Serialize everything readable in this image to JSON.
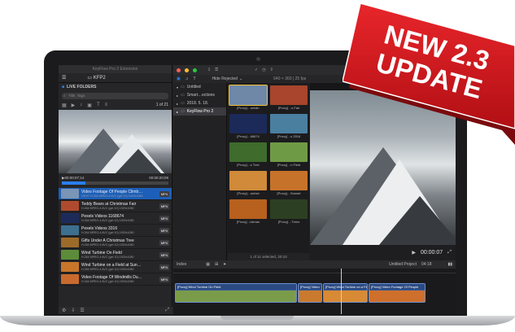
{
  "left_app": {
    "window_title": "KeyFlow Pro 2 Extension",
    "library": "KFP2",
    "folders_label": "LIVE FOLDERS",
    "search_placeholder": "Title, Tags",
    "page": "1 of 21",
    "time_current": "00:00:07;14",
    "time_total": "00:00:20;09",
    "clips": [
      {
        "name": "Video Footage Of People Climb…",
        "meta": "HEVC H.264 MPEG-4 AVC (get 10) 1920x1080",
        "badge": "MP4",
        "color": "#7a95b5"
      },
      {
        "name": "Teddy Bears at Christmas Fair",
        "meta": "H.264 MPEG-4 AVC (get 10) 1920x1080",
        "badge": "MP4",
        "color": "#b04a2e"
      },
      {
        "name": "Pexels Videos 1168674",
        "meta": "H.264 MPEG-4 AVC (get 10) 1920x1080",
        "badge": "MP4",
        "color": "#1c2b5a"
      },
      {
        "name": "Pexels Videos 3316",
        "meta": "H.264 MPEG-4 AVC (get 10) 1920x1080",
        "badge": "MP4",
        "color": "#3d6f8f"
      },
      {
        "name": "Gifts Under A Christmas Tree",
        "meta": "H.264 MPEG-4 AVC (get 10) 1920x1080",
        "badge": "MP4",
        "color": "#9c6b2a"
      },
      {
        "name": "Wind Turbine On Field",
        "meta": "H.264 MPEG-4 AVC (get 10) 1920x1080",
        "badge": "MP4",
        "color": "#5c8c3a"
      },
      {
        "name": "Wind Turbine on a Field at Sun…",
        "meta": "H.264 MPEG-4 AVC (get 10) 1920x1080",
        "badge": "MP4",
        "color": "#c9762a"
      },
      {
        "name": "Video Footage Of Windmills Du…",
        "meta": "H.264 MPEG-4 AVC (get 10) 1920x1080",
        "badge": "MP4",
        "color": "#c96b2e"
      }
    ]
  },
  "right_app": {
    "filter": "Hide Rejected",
    "viewer_info": "640 × 360 | 25 fps",
    "libraries": [
      {
        "label": "Untitled",
        "selected": false
      },
      {
        "label": "Smart…ections",
        "selected": false
      },
      {
        "label": "2018. 5. 18.",
        "selected": false
      },
      {
        "label": "KeyFlow Pro 2",
        "selected": true
      }
    ],
    "browser_clips": [
      {
        "label": "[Proxy]…untain",
        "color": "#6f88a8",
        "selected": true
      },
      {
        "label": "[Proxy]…s Fair",
        "color": "#a8452c",
        "selected": false
      },
      {
        "label": "[Proxy]…68674",
        "color": "#1b2a59",
        "selected": false
      },
      {
        "label": "[Proxy]…s 3316",
        "color": "#4a7fa0",
        "selected": false
      },
      {
        "label": "[Proxy]…s Tree",
        "color": "#3f6b2d",
        "selected": false
      },
      {
        "label": "[Proxy]…n Field",
        "color": "#6f9a45",
        "selected": false
      },
      {
        "label": "[Proxy]…unrise",
        "color": "#d08a3a",
        "selected": false
      },
      {
        "label": "[Proxy]…Sunset",
        "color": "#c7722a",
        "selected": false
      },
      {
        "label": "[Proxy]…istmas",
        "color": "#b8601e",
        "selected": false
      },
      {
        "label": "[Proxy]…Trees",
        "color": "#2d3f22",
        "selected": false
      }
    ],
    "browser_status": "1 of 11 selected, 20:10",
    "index_label": "Index",
    "project": "Untitled Project",
    "project_duration": "04:18",
    "timecode": "00:00:07",
    "timeline_clips": [
      {
        "label": "[Proxy] Wind Turbine On Field",
        "width": 150,
        "color": "#7a9c4a"
      },
      {
        "label": "[Proxy] Video",
        "width": 30,
        "color": "#c97a2e"
      },
      {
        "label": "[Proxy] Wind Turbine on a Field",
        "width": 55,
        "color": "#d88a34"
      },
      {
        "label": "[Proxy] Video Footage Of People",
        "width": 70,
        "color": "#cf6f2c"
      }
    ]
  },
  "promo_ribbon": {
    "line1": "NEW 2.3",
    "line2": "UPDATE",
    "color": "#d0161b"
  }
}
